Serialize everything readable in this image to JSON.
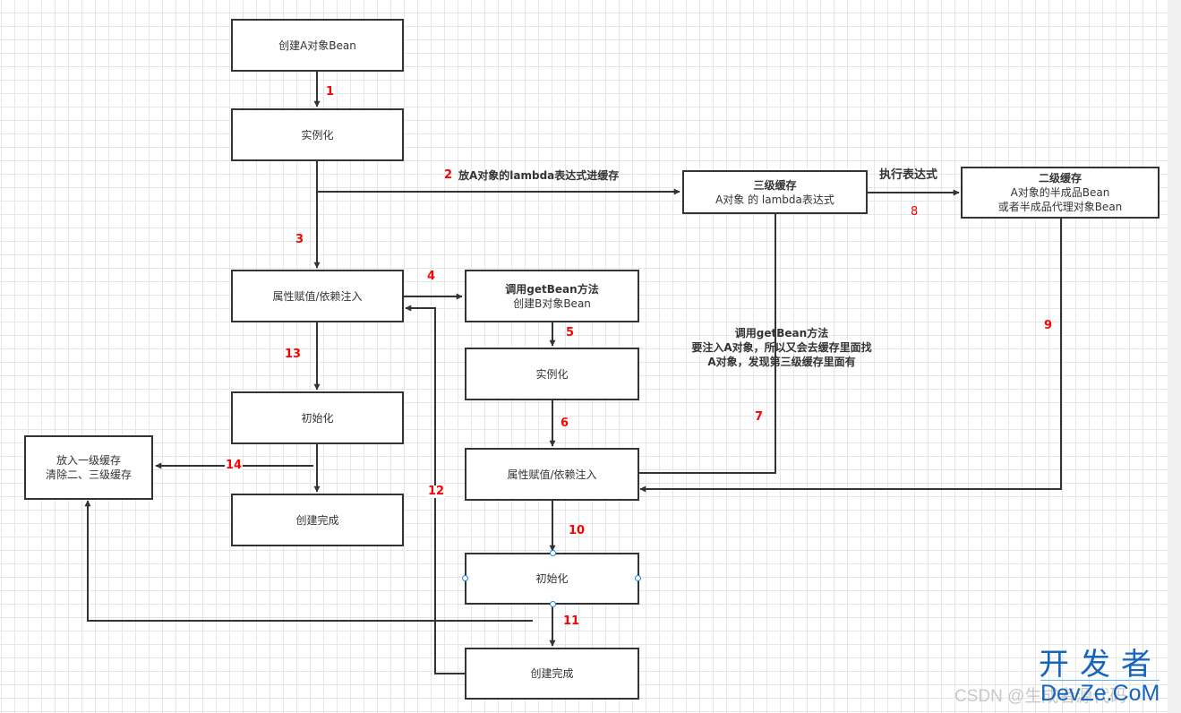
{
  "colors": {
    "stroke": "#333333",
    "step_number": "#ff0000",
    "grid": "#e6e6e6",
    "selection_handle": "#1e88e5",
    "watermark_brand": "#1565c0"
  },
  "nodes": {
    "a_create": {
      "text": "创建A对象Bean"
    },
    "a_instantiate": {
      "text": "实例化"
    },
    "a_populate": {
      "text": "属性赋值/依赖注入"
    },
    "a_initialize": {
      "text": "初始化"
    },
    "a_done": {
      "text": "创建完成"
    },
    "first_cache": {
      "line1": "放入一级缓存",
      "line2": "清除二、三级缓存"
    },
    "b_getbean": {
      "title": "调用getBean方法",
      "text": "创建B对象Bean"
    },
    "b_instantiate": {
      "text": "实例化"
    },
    "b_populate": {
      "text": "属性赋值/依赖注入"
    },
    "b_initialize": {
      "text": "初始化"
    },
    "b_done": {
      "text": "创建完成"
    },
    "third_cache": {
      "title": "三级缓存",
      "text": "A对象 的 lambda表达式"
    },
    "second_cache": {
      "title": "二级缓存",
      "line1": "A对象的半成品Bean",
      "line2": "或者半成品代理对象Bean"
    }
  },
  "edge_labels": {
    "put_lambda": "放A对象的lambda表达式进缓存",
    "execute_expression": "执行表达式",
    "getbean_note": {
      "line1": "调用getBean方法",
      "line2": "要注入A对象，所以又会去缓存里面找",
      "line3": "A对象，发现第三级缓存里面有"
    }
  },
  "steps": {
    "s1": "1",
    "s2": "2",
    "s3": "3",
    "s4": "4",
    "s5": "5",
    "s6": "6",
    "s7": "7",
    "s8": "8",
    "s9": "9",
    "s10": "10",
    "s11": "11",
    "s12": "12",
    "s13": "13",
    "s14": "14"
  },
  "watermark": {
    "csdn": "CSDN @生成者源代码",
    "brand_cn": "开发者",
    "brand_en": "DevZe.CoM"
  }
}
